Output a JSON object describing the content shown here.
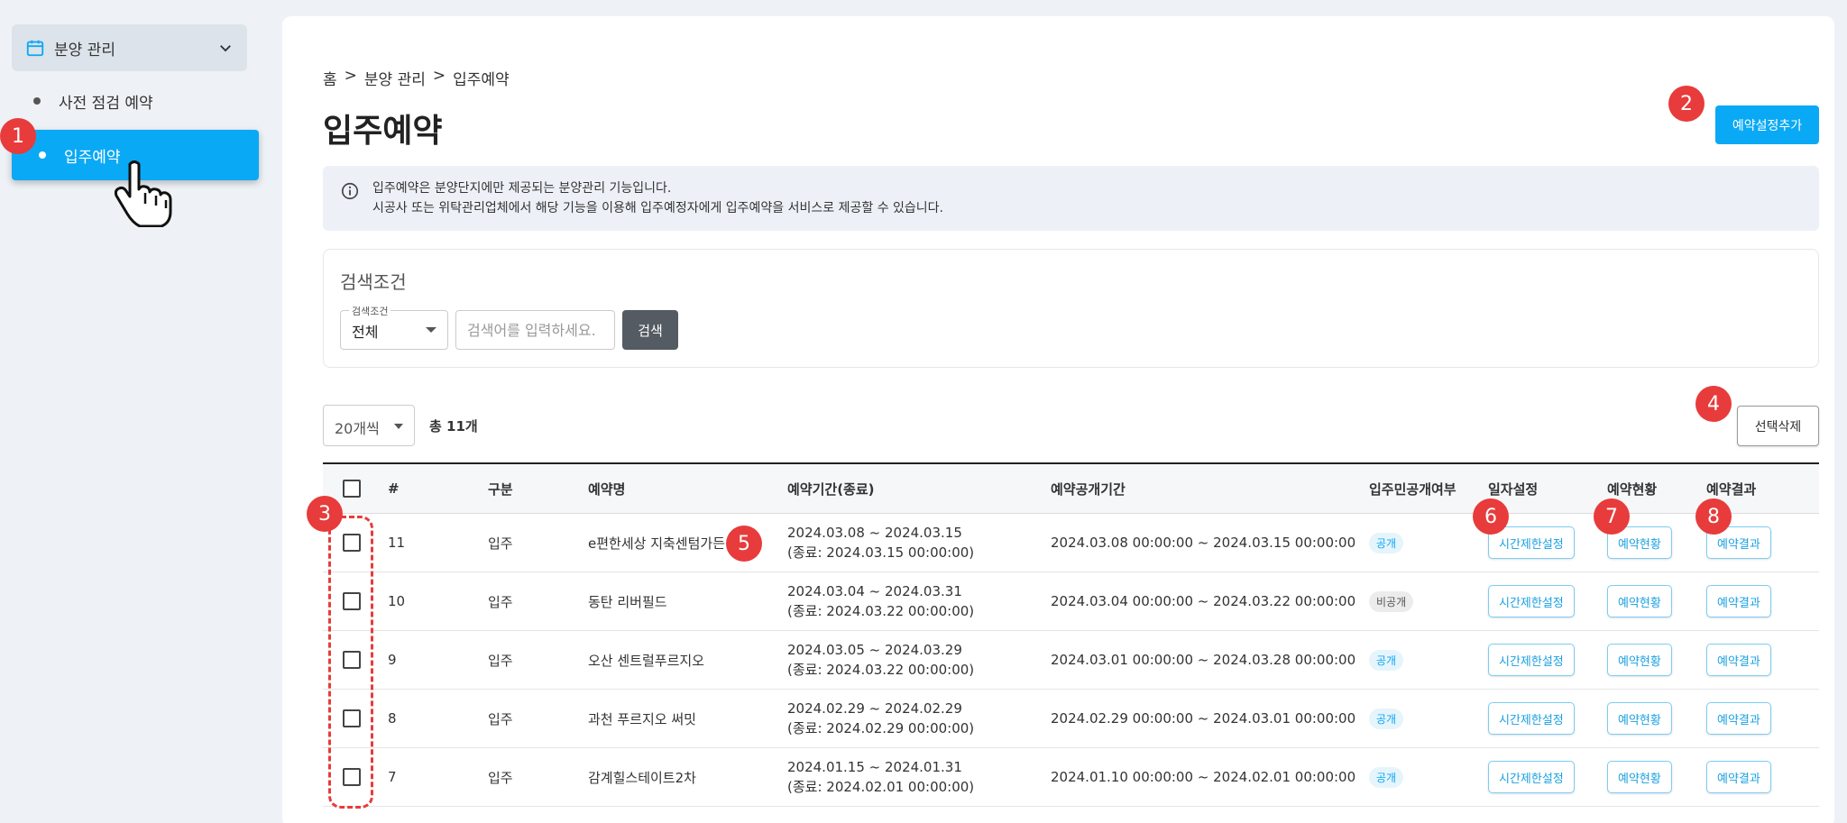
{
  "sidebar": {
    "group_label": "분양 관리",
    "items": [
      {
        "label": "사전 점검 예약"
      },
      {
        "label": "입주예약"
      }
    ]
  },
  "breadcrumb": [
    "홈",
    ">",
    "분양 관리",
    ">",
    "입주예약"
  ],
  "page_title": "입주예약",
  "add_button": "예약설정추가",
  "info": {
    "line1": "입주예약은 분양단지에만 제공되는 분양관리 기능입니다.",
    "line2": "시공사 또는 위탁관리업체에서 해당 기능을 이용해 입주예정자에게 입주예약을 서비스로 제공할 수 있습니다."
  },
  "search": {
    "title": "검색조건",
    "select_legend": "검색조건",
    "select_value": "전체",
    "placeholder": "검색어를 입력하세요.",
    "button": "검색"
  },
  "list": {
    "page_size": "20개씩",
    "total": "총 11개",
    "delete_button": "선택삭제"
  },
  "table": {
    "headers": [
      "#",
      "구분",
      "예약명",
      "예약기간(종료)",
      "예약공개기간",
      "입주민공개여부",
      "일자설정",
      "예약현황",
      "예약결과"
    ],
    "action_labels": {
      "time": "시간제한설정",
      "status": "예약현황",
      "result": "예약결과"
    },
    "rows": [
      {
        "no": "11",
        "type": "입주",
        "name": "e편한세상 지축센텀가든",
        "period": "2024.03.08 ~ 2024.03.15",
        "end": "(종료: 2024.03.15 00:00:00)",
        "open_period": "2024.03.08 00:00:00 ~ 2024.03.15 00:00:00",
        "visibility": "공개"
      },
      {
        "no": "10",
        "type": "입주",
        "name": "동탄 리버필드",
        "period": "2024.03.04 ~ 2024.03.31",
        "end": "(종료: 2024.03.22 00:00:00)",
        "open_period": "2024.03.04 00:00:00 ~ 2024.03.22 00:00:00",
        "visibility": "비공개"
      },
      {
        "no": "9",
        "type": "입주",
        "name": "오산 센트럴푸르지오",
        "period": "2024.03.05 ~ 2024.03.29",
        "end": "(종료: 2024.03.22 00:00:00)",
        "open_period": "2024.03.01 00:00:00 ~ 2024.03.28 00:00:00",
        "visibility": "공개"
      },
      {
        "no": "8",
        "type": "입주",
        "name": "과천 푸르지오 써밋",
        "period": "2024.02.29 ~ 2024.02.29",
        "end": "(종료: 2024.02.29 00:00:00)",
        "open_period": "2024.02.29 00:00:00 ~ 2024.03.01 00:00:00",
        "visibility": "공개"
      },
      {
        "no": "7",
        "type": "입주",
        "name": "감계힐스테이트2차",
        "period": "2024.01.15 ~ 2024.01.31",
        "end": "(종료: 2024.02.01 00:00:00)",
        "open_period": "2024.01.10 00:00:00 ~ 2024.02.01 00:00:00",
        "visibility": "공개"
      }
    ]
  },
  "markers": [
    "1",
    "2",
    "3",
    "4",
    "5",
    "6",
    "7",
    "8"
  ],
  "colors": {
    "accent": "#0aa9f5",
    "marker": "#e83b3b",
    "dark_button": "#555b62"
  }
}
